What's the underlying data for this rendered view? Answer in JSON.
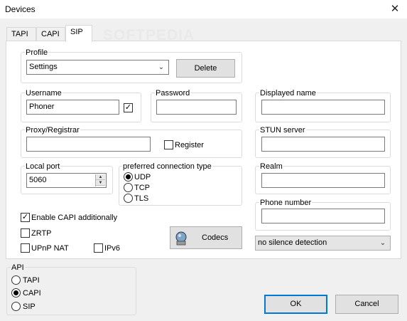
{
  "window": {
    "title": "Devices",
    "close_glyph": "✕"
  },
  "tabs": [
    {
      "label": "TAPI"
    },
    {
      "label": "CAPI"
    },
    {
      "label": "SIP",
      "active": true
    }
  ],
  "watermark": "SOFTPEDIA",
  "profile": {
    "group_label": "Profile",
    "selected": "Settings",
    "delete_label": "Delete"
  },
  "username": {
    "group_label": "Username",
    "value": "Phoner",
    "checked": true
  },
  "password": {
    "group_label": "Password",
    "value": ""
  },
  "proxy": {
    "group_label": "Proxy/Registrar",
    "value": "",
    "register_label": "Register",
    "register_checked": false
  },
  "local_port": {
    "group_label": "Local port",
    "value": "5060"
  },
  "connection": {
    "group_label": "preferred connection type",
    "options": [
      {
        "label": "UDP",
        "selected": true
      },
      {
        "label": "TCP",
        "selected": false
      },
      {
        "label": "TLS",
        "selected": false
      }
    ]
  },
  "options": {
    "enable_capi": {
      "label": "Enable CAPI additionally",
      "checked": true
    },
    "zrtp": {
      "label": "ZRTP",
      "checked": false
    },
    "upnp": {
      "label": "UPnP NAT",
      "checked": false
    },
    "ipv6": {
      "label": "IPv6",
      "checked": false
    }
  },
  "codecs_label": "Codecs",
  "displayed_name": {
    "group_label": "Displayed name",
    "value": ""
  },
  "stun_server": {
    "group_label": "STUN server",
    "value": ""
  },
  "realm": {
    "group_label": "Realm",
    "value": ""
  },
  "phone_number": {
    "group_label": "Phone number",
    "value": ""
  },
  "silence": {
    "selected": "no silence detection"
  },
  "api": {
    "group_label": "API",
    "options": [
      {
        "label": "TAPI",
        "selected": false
      },
      {
        "label": "CAPI",
        "selected": true
      },
      {
        "label": "SIP",
        "selected": false
      }
    ]
  },
  "buttons": {
    "ok": "OK",
    "cancel": "Cancel"
  },
  "colors": {
    "accent": "#0078d7",
    "background": "#f0f0f0"
  }
}
